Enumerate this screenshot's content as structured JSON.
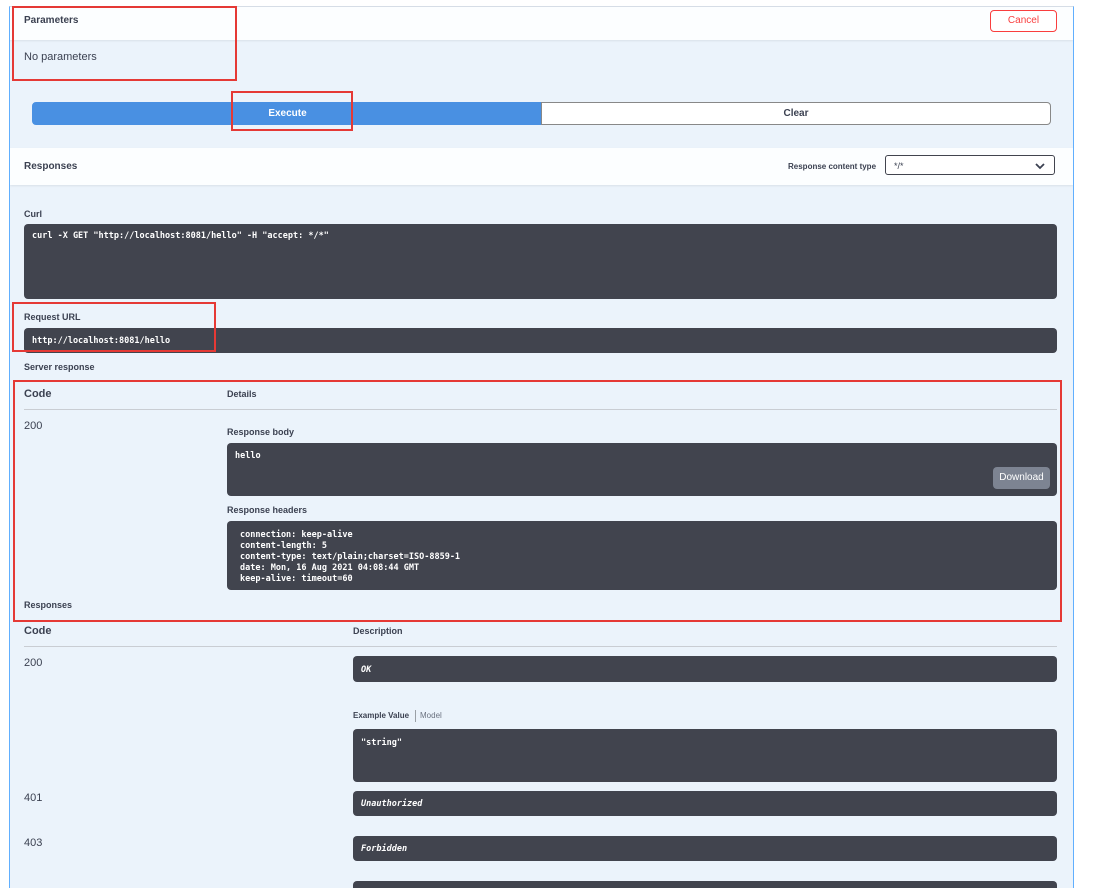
{
  "parameters": {
    "title": "Parameters",
    "cancel_label": "Cancel",
    "empty_text": "No parameters"
  },
  "actions": {
    "execute_label": "Execute",
    "clear_label": "Clear"
  },
  "responses_bar": {
    "title": "Responses",
    "content_type_label": "Response content type",
    "content_type_value": "*/*"
  },
  "curl": {
    "label": "Curl",
    "command": "curl -X GET \"http://localhost:8081/hello\" -H \"accept: */*\""
  },
  "request_url": {
    "label": "Request URL",
    "value": "http://localhost:8081/hello"
  },
  "server_response": {
    "label": "Server response",
    "col_code": "Code",
    "col_details": "Details",
    "code": "200",
    "body_label": "Response body",
    "body": "hello",
    "download_label": "Download",
    "headers_label": "Response headers",
    "headers": [
      "connection: keep-alive",
      "content-length: 5",
      "content-type: text/plain;charset=ISO-8859-1",
      "date: Mon, 16 Aug 2021 04:08:44 GMT",
      "keep-alive: timeout=60"
    ]
  },
  "responses_table": {
    "title": "Responses",
    "col_code": "Code",
    "col_description": "Description",
    "rows": [
      {
        "code": "200",
        "description": "OK"
      },
      {
        "code": "401",
        "description": "Unauthorized"
      },
      {
        "code": "403",
        "description": "Forbidden"
      }
    ],
    "example_value_tab": "Example Value",
    "model_tab": "Model",
    "example_value": "\"string\""
  },
  "colors": {
    "accent": "#4990e2",
    "cancel": "#f93e3e",
    "highlight_box": "#e53935",
    "code_bg": "#41444e",
    "panel_bg": "#ebf3fb"
  }
}
